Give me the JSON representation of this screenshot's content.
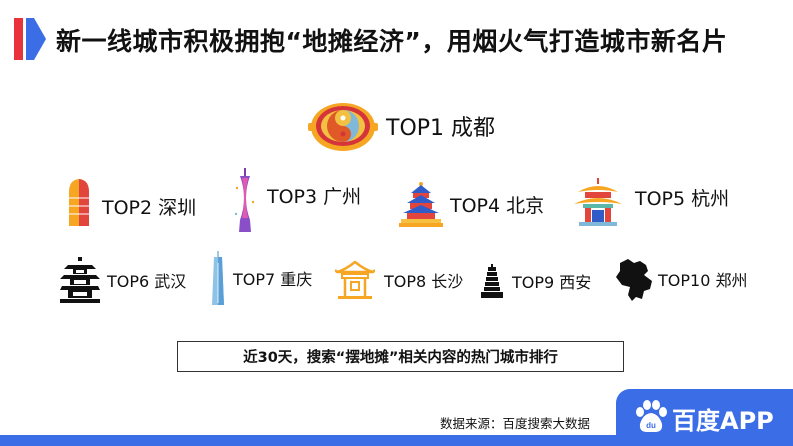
{
  "header": {
    "title": "新一线城市积极拥抱“地摊经济”，用烟火气打造城市新名片"
  },
  "ranking": [
    {
      "label": "TOP1 成都",
      "icon": "hotpot-icon"
    },
    {
      "label": "TOP2 深圳",
      "icon": "skyscraper-icon"
    },
    {
      "label": "TOP3 广州",
      "icon": "canton-tower-icon"
    },
    {
      "label": "TOP4 北京",
      "icon": "temple-of-heaven-icon"
    },
    {
      "label": "TOP5 杭州",
      "icon": "pagoda-icon"
    },
    {
      "label": "TOP6 武汉",
      "icon": "yellow-crane-tower-icon"
    },
    {
      "label": "TOP7 重庆",
      "icon": "tower-icon"
    },
    {
      "label": "TOP8 长沙",
      "icon": "pavilion-icon"
    },
    {
      "label": "TOP9 西安",
      "icon": "wild-goose-pagoda-icon"
    },
    {
      "label": "TOP10 郑州",
      "icon": "map-outline-icon"
    }
  ],
  "caption": "近30天，搜索“摆地摊”相关内容的热门城市排行",
  "source": "数据来源：百度搜索大数据",
  "brand": {
    "name": "百度APP",
    "logo_text": "du"
  },
  "colors": {
    "accent_red": "#e8333c",
    "accent_blue": "#3b6de6"
  }
}
